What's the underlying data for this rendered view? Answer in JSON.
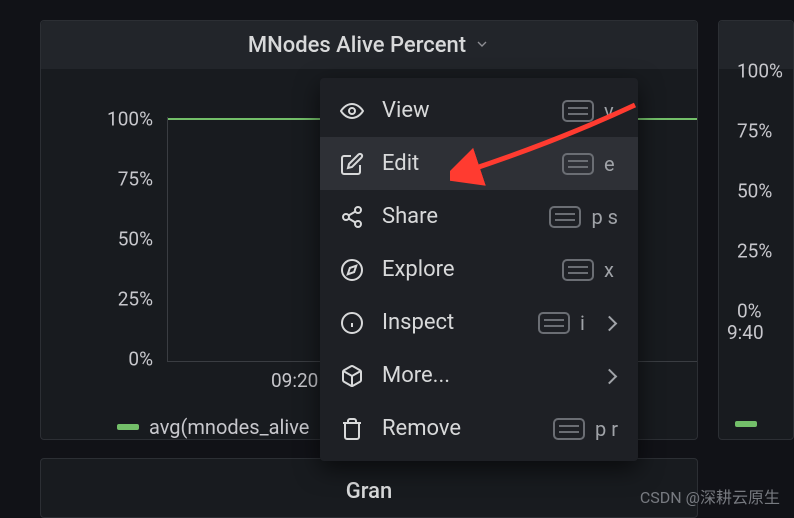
{
  "panel": {
    "title": "MNodes Alive Percent",
    "y_ticks": [
      "100%",
      "75%",
      "50%",
      "25%",
      "0%"
    ],
    "x_ticks": [
      "09:20",
      "9:40"
    ],
    "legend": "avg(mnodes_alive"
  },
  "panel_right": {
    "y_ticks": [
      "100%",
      "75%",
      "50%",
      "25%",
      "0%"
    ]
  },
  "panel_bottom": {
    "title": "Gran"
  },
  "menu": {
    "items": [
      {
        "label": "View",
        "key": "v"
      },
      {
        "label": "Edit",
        "key": "e"
      },
      {
        "label": "Share",
        "key": "p s"
      },
      {
        "label": "Explore",
        "key": "x"
      },
      {
        "label": "Inspect",
        "key": "i",
        "submenu": true
      },
      {
        "label": "More...",
        "submenu": true
      },
      {
        "label": "Remove",
        "key": "p r"
      }
    ]
  },
  "chart_data": {
    "type": "line",
    "title": "MNodes Alive Percent",
    "ylabel": "",
    "ylim": [
      0,
      100
    ],
    "y_ticks": [
      0,
      25,
      50,
      75,
      100
    ],
    "x_ticks": [
      "09:20",
      "09:40"
    ],
    "series": [
      {
        "name": "avg(mnodes_alive",
        "values_constant": 100
      }
    ]
  },
  "watermark": "CSDN @深耕云原生"
}
